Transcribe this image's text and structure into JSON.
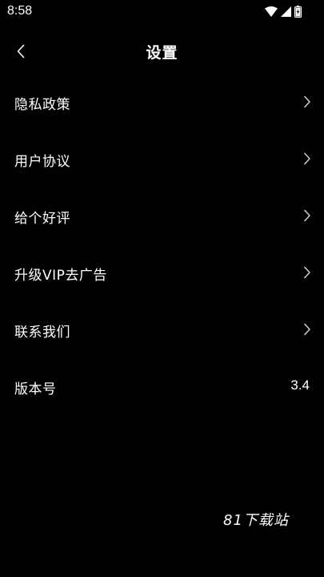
{
  "status_bar": {
    "time": "8:58",
    "icons": [
      "wifi-icon",
      "signal-icon",
      "battery-charging-icon"
    ]
  },
  "header": {
    "back_icon": "chevron-left-icon",
    "title": "设置"
  },
  "settings": {
    "items": [
      {
        "label": "隐私政策",
        "icon": "chevron-right-icon"
      },
      {
        "label": "用户协议",
        "icon": "chevron-right-icon"
      },
      {
        "label": "给个好评",
        "icon": "chevron-right-icon"
      },
      {
        "label": "升级VIP去广告",
        "icon": "chevron-right-icon"
      },
      {
        "label": "联系我们",
        "icon": "chevron-right-icon"
      }
    ],
    "version": {
      "label": "版本号",
      "value": "3.4"
    }
  },
  "watermark": "81下载站",
  "colors": {
    "background": "#000000",
    "text": "#ffffff",
    "chevron": "#cfcfcf"
  }
}
